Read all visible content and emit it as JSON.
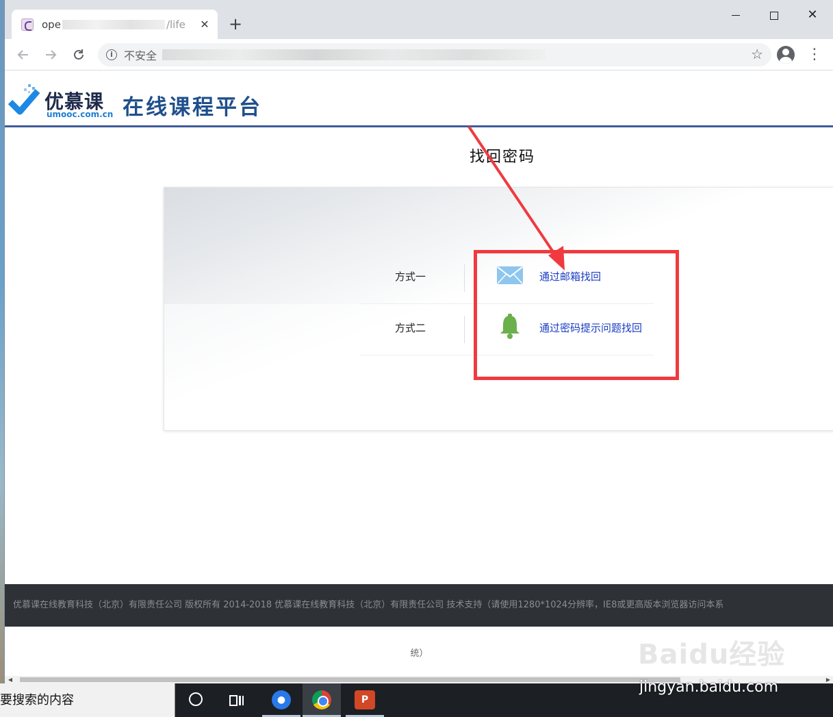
{
  "browser": {
    "tab_title_start": "ope",
    "tab_title_end": "/life",
    "tab_close": "✕",
    "new_tab": "+",
    "insecure_label": "不安全",
    "bookmark_icon": "star-icon",
    "menu_icon": "⋮"
  },
  "site": {
    "logo_name": "优慕课",
    "logo_domain": "umooc.com.cn",
    "platform_title": "在线课程平台"
  },
  "main": {
    "heading": "找回密码",
    "methods": [
      {
        "label": "方式一",
        "link": "通过邮箱找回",
        "icon": "mail-icon"
      },
      {
        "label": "方式二",
        "link": "通过密码提示问题找回",
        "icon": "bell-icon"
      }
    ]
  },
  "footer": {
    "text": "优慕课在线教育科技（北京）有限责任公司 版权所有 2014-2018 优慕课在线教育科技（北京）有限责任公司 技术支持（请使用1280*1024分辨率，IE8或更高版本浏览器访问本系",
    "text_tail": "统）"
  },
  "taskbar": {
    "search_placeholder": "要搜索的内容"
  },
  "watermark": {
    "brand": "Baidu经验",
    "url": "jingyan.baidu.com"
  },
  "colors": {
    "annotation_red": "#f03a3f",
    "link_blue": "#1a3dc2",
    "header_rule": "#3e5b9a",
    "footer_bg": "#2e3136"
  }
}
